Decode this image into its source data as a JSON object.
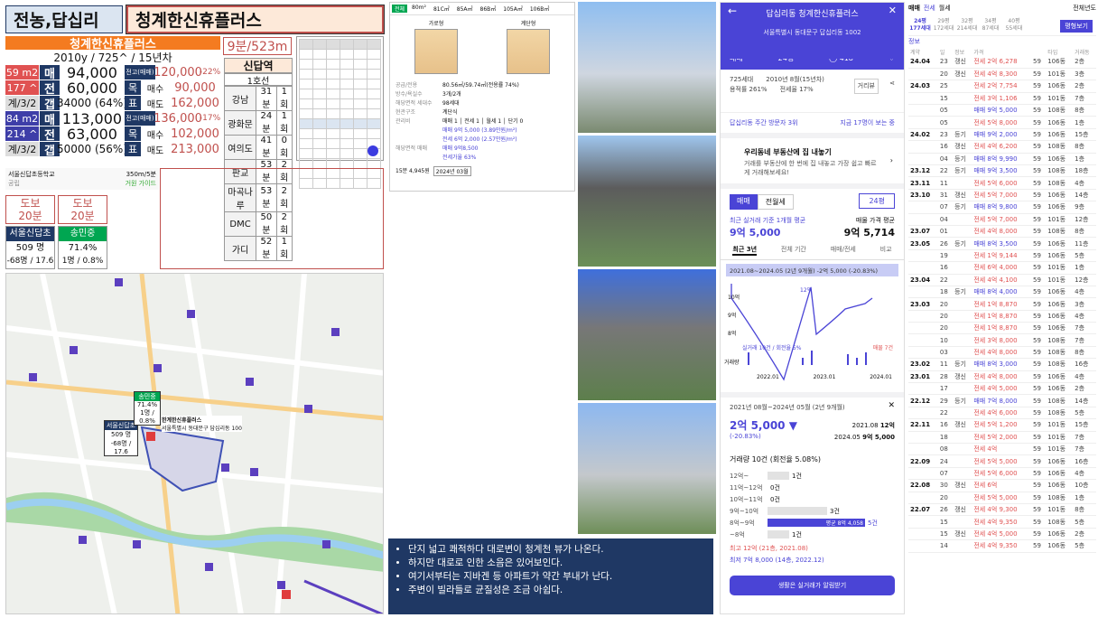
{
  "titles": {
    "area": "전농,답십리",
    "complex": "청계한신휴플러스"
  },
  "summary": {
    "name": "청계한신휴플러스",
    "info": "2010y / 725^ / 15년차",
    "walk": "9분/523m",
    "rows": [
      {
        "a": "59 m2",
        "b": "매",
        "c": "94,000",
        "d": "전고(매매)",
        "e": "120,000",
        "f": "-22%"
      },
      {
        "a": "177 ^",
        "b": "전",
        "c": "60,000",
        "d": "목",
        "e": "매수",
        "f": "90,000"
      },
      {
        "a": "계/3/2",
        "b": "갭",
        "c": "34000 (64%)",
        "d": "표",
        "e": "매도",
        "f": "162,000"
      },
      {
        "a": "84 m2",
        "b": "매",
        "c": "113,000",
        "d": "전고(매매)",
        "e": "136,000",
        "f": "-17%"
      },
      {
        "a": "214 ^",
        "b": "전",
        "c": "63,000",
        "d": "목",
        "e": "매수",
        "f": "102,000"
      },
      {
        "a": "계/3/2",
        "b": "갭",
        "c": "50000 (56%)",
        "d": "표",
        "e": "매도",
        "f": "213,000"
      }
    ]
  },
  "station": {
    "name": "신답역",
    "line": "1호선",
    "rows": [
      [
        "강남",
        "31분",
        "1회"
      ],
      [
        "광화문",
        "24분",
        "1회"
      ],
      [
        "여의도",
        "41분",
        "0회"
      ],
      [
        "판교",
        "53분",
        "2회"
      ],
      [
        "마곡나루",
        "53분",
        "2회"
      ],
      [
        "DMC",
        "50분",
        "2회"
      ],
      [
        "가디",
        "52분",
        "1회"
      ]
    ]
  },
  "school": {
    "name": "서울신답초등학교",
    "dist": "350m/5분",
    "tag1": "공립",
    "tag2": "거원 가이드"
  },
  "walk": [
    {
      "l1": "도보",
      "l2": "20분"
    },
    {
      "l1": "도보",
      "l2": "20분"
    }
  ],
  "schools": [
    {
      "name": "서울신답초",
      "v1": "509 명",
      "v2": "-68명 / 17.6"
    },
    {
      "name": "송민중",
      "v1": "71.4%",
      "v2": "1명 / 0.8%"
    }
  ],
  "plan": {
    "tabs": [
      "전체",
      "80m²",
      "81C㎡",
      "85A㎡",
      "86B㎡",
      "105A㎡",
      "106B㎡"
    ],
    "labels": [
      "가로형",
      "계단형"
    ],
    "specs": [
      [
        "공급/전용",
        "80.56㎡/59.74㎡(전용률 74%)"
      ],
      [
        "방수/욕실수",
        "3개/2개"
      ],
      [
        "해당면적 세대수",
        "98세대"
      ],
      [
        "현관구조",
        "계단식"
      ],
      [
        "관리비",
        "매매 1 │ 전세 1 │ 월세 1 │ 단기 0"
      ],
      [
        "",
        "매매 9억 5,000 (3.89만원/m²)"
      ],
      [
        "",
        "전세 6억 2,000 (2.57만원/m²)"
      ],
      [
        "해당면적 매매",
        "매매 9억8,500"
      ],
      [
        "",
        "전세가율 63%"
      ]
    ],
    "foot1": "15분 4,945원",
    "foot2": "2024년 03월"
  },
  "notes": [
    "단지 넓고 쾌적하다 대로변이 청계천 뷰가 나온다.",
    "하지만 대로로 인한 소음은 있어보인다.",
    "여기서부터는 지바겐 등 아파트가 약간 부내가 난다.",
    "주변이 빌라들로 균질성은 조금 아쉽다."
  ],
  "map": {
    "school_lbl": "서울신답초",
    "school_v1": "509 명",
    "school_v2": "-68명 / 17.6",
    "mid_lbl": "송민중",
    "mid_v1": "71.4%",
    "mid_v2": "1명 / 0.8%",
    "complex_lbl": "한계한신휴플러스",
    "complex_sub": "서울특별시 동대문구 답십리동 100"
  },
  "app": {
    "title": "답십리동 청계한신휴플러스",
    "addr": "서울특별시 동대문구 답십리동 1002",
    "mode": "매매",
    "size": "24평",
    "count": "418",
    "households": "725세대",
    "built": "2010년 8월(15년차)",
    "ratio1": "용적률 261%",
    "ratio2": "전세율 17%",
    "nearby": "거리뷰",
    "rank": "답십리동 주간 방문자 3위",
    "rank_link": "지금 17명이 보는 중",
    "promo_title": "우리동네 부동산에 집 내놓기",
    "promo_body": "거래를 부동산에 한 번에 집 내놓고 가장 쉽고 빠르게 거래해보세요!",
    "tabs2": [
      "매매",
      "전월세"
    ],
    "size2": "24평",
    "recent_lbl": "최근 실거래 기준 1개월 평균",
    "recent_val": "9억 5,000",
    "ask_lbl": "매물 가격 평균",
    "ask_val": "9억 5,714",
    "period_tabs": [
      "최근 3년",
      "전체 기간",
      "매매/전세",
      "비교"
    ],
    "band": "2021.08~2024.05 (2년 9개월)  -2억 5,000 (-20.83%)",
    "y1": "10억",
    "y2": "9억",
    "y3": "8억",
    "xl": [
      "2022.01",
      "2023.01",
      "2024.01"
    ],
    "vol": "실거래 10건 / 회전율 5%",
    "volr": "매물 7건",
    "vlbl": "거래량",
    "peak": "12억",
    "period2": "2021년 08월~2024년 05월 (2년 9개월)",
    "diff": "2억 5,000 ▼",
    "pct": "(-20.83%)",
    "d1": "2021.08",
    "v1": "12억",
    "d2": "2024.05",
    "v2": "9억 5,000",
    "vol2": "거래량 10건 (회전율 5.08%)",
    "dist": [
      {
        "l": "12억~",
        "n": "1건",
        "w": 24
      },
      {
        "l": "11억~12억",
        "n": "0건",
        "w": 0
      },
      {
        "l": "10억~11억",
        "n": "0건",
        "w": 0
      },
      {
        "l": "9억~10억",
        "n": "3건",
        "w": 66
      },
      {
        "l": "8억~9억",
        "n": "5건",
        "w": 108,
        "hi": true,
        "t": "평균 8억 4,058"
      },
      {
        "l": "~8억",
        "n": "1건",
        "w": 24
      }
    ],
    "max": "최고 12억 (21층, 2021.08)",
    "min": "최저 7억 8,000 (14층, 2022.12)",
    "cta": "생활은 실거래가 알림받기"
  },
  "tx": {
    "tabs": [
      "매매",
      "전세",
      "월세"
    ],
    "filter": "전체년도",
    "sizes": [
      [
        "24평",
        "177세대"
      ],
      [
        "29평",
        "172세대"
      ],
      [
        "32평",
        "214세대"
      ],
      [
        "34평",
        "87세대"
      ],
      [
        "40평",
        "55세대"
      ]
    ],
    "btn": "평형보기",
    "info": "정보",
    "headers": [
      "계약",
      "일",
      "정보",
      "가격",
      "",
      "타입",
      "거래동"
    ],
    "rows": [
      [
        "24.04",
        "23",
        "갱신",
        "전세 2억 6,278",
        "59",
        "106동",
        "2층"
      ],
      [
        "",
        "20",
        "갱신",
        "전세 4억 8,300",
        "59",
        "101동",
        "3층"
      ],
      [
        "24.03",
        "25",
        "",
        "전세 2억 7,754",
        "59",
        "106동",
        "2층"
      ],
      [
        "",
        "15",
        "",
        "전세 3억 1,106",
        "59",
        "101동",
        "7층"
      ],
      [
        "",
        "05",
        "",
        "매매 9억 5,000",
        "59",
        "108동",
        "8층"
      ],
      [
        "",
        "05",
        "",
        "전세 5억 8,000",
        "59",
        "106동",
        "1층"
      ],
      [
        "24.02",
        "23",
        "등기",
        "매매 9억 2,000",
        "59",
        "106동",
        "15층"
      ],
      [
        "",
        "16",
        "갱신",
        "전세 4억 6,200",
        "59",
        "108동",
        "8층"
      ],
      [
        "",
        "04",
        "등기",
        "매매 8억 9,990",
        "59",
        "106동",
        "1층"
      ],
      [
        "23.12",
        "22",
        "등기",
        "매매 9억 3,500",
        "59",
        "108동",
        "18층"
      ],
      [
        "23.11",
        "11",
        "",
        "전세 5억 6,000",
        "59",
        "108동",
        "4층"
      ],
      [
        "23.10",
        "31",
        "갱신",
        "전세 5억 7,000",
        "59",
        "106동",
        "14층"
      ],
      [
        "",
        "07",
        "등기",
        "매매 8억 9,800",
        "59",
        "106동",
        "9층"
      ],
      [
        "",
        "04",
        "",
        "전세 5억 7,000",
        "59",
        "101동",
        "12층"
      ],
      [
        "23.07",
        "01",
        "",
        "전세 4억 8,000",
        "59",
        "108동",
        "8층"
      ],
      [
        "23.05",
        "26",
        "등기",
        "매매 8억 3,500",
        "59",
        "106동",
        "11층"
      ],
      [
        "",
        "19",
        "",
        "전세 1억 9,144",
        "59",
        "106동",
        "5층"
      ],
      [
        "",
        "16",
        "",
        "전세 6억 4,000",
        "59",
        "101동",
        "1층"
      ],
      [
        "23.04",
        "22",
        "",
        "전세 4억 4,100",
        "59",
        "101동",
        "12층"
      ],
      [
        "",
        "18",
        "등기",
        "매매 8억 4,000",
        "59",
        "106동",
        "4층"
      ],
      [
        "23.03",
        "20",
        "",
        "전세 1억 8,870",
        "59",
        "106동",
        "3층"
      ],
      [
        "",
        "20",
        "",
        "전세 1억 8,870",
        "59",
        "106동",
        "4층"
      ],
      [
        "",
        "20",
        "",
        "전세 1억 8,870",
        "59",
        "106동",
        "7층"
      ],
      [
        "",
        "10",
        "",
        "전세 3억 8,000",
        "59",
        "108동",
        "7층"
      ],
      [
        "",
        "03",
        "",
        "전세 4억 8,000",
        "59",
        "108동",
        "8층"
      ],
      [
        "23.02",
        "11",
        "등기",
        "매매 8억 3,000",
        "59",
        "108동",
        "16층"
      ],
      [
        "23.01",
        "28",
        "갱신",
        "전세 4억 8,000",
        "59",
        "106동",
        "4층"
      ],
      [
        "",
        "17",
        "",
        "전세 4억 5,000",
        "59",
        "106동",
        "2층"
      ],
      [
        "22.12",
        "29",
        "등기",
        "매매 7억 8,000",
        "59",
        "108동",
        "14층"
      ],
      [
        "",
        "22",
        "",
        "전세 4억 6,000",
        "59",
        "108동",
        "5층"
      ],
      [
        "22.11",
        "16",
        "갱신",
        "전세 5억 1,200",
        "59",
        "101동",
        "15층"
      ],
      [
        "",
        "18",
        "",
        "전세 5억 2,000",
        "59",
        "101동",
        "7층"
      ],
      [
        "",
        "08",
        "",
        "전세 4억",
        "59",
        "101동",
        "7층"
      ],
      [
        "22.09",
        "24",
        "",
        "전세 5억 5,000",
        "59",
        "106동",
        "16층"
      ],
      [
        "",
        "07",
        "",
        "전세 5억 6,000",
        "59",
        "106동",
        "4층"
      ],
      [
        "22.08",
        "30",
        "갱신",
        "전세 6억",
        "59",
        "106동",
        "10층"
      ],
      [
        "",
        "20",
        "",
        "전세 5억 5,000",
        "59",
        "108동",
        "1층"
      ],
      [
        "22.07",
        "26",
        "갱신",
        "전세 4억 9,300",
        "59",
        "101동",
        "8층"
      ],
      [
        "",
        "15",
        "",
        "전세 4억 9,350",
        "59",
        "108동",
        "5층"
      ],
      [
        "",
        "15",
        "갱신",
        "전세 4억 5,000",
        "59",
        "106동",
        "2층"
      ],
      [
        "",
        "14",
        "",
        "전세 4억 9,350",
        "59",
        "106동",
        "5층"
      ]
    ]
  }
}
